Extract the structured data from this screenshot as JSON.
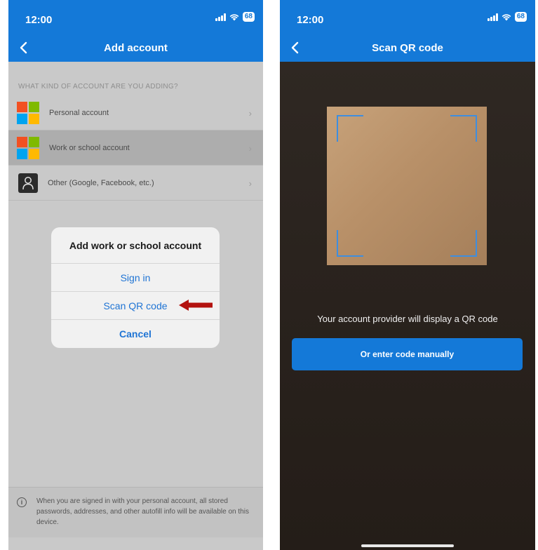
{
  "left": {
    "status_time": "12:00",
    "battery": "68",
    "nav_title": "Add account",
    "section_header": "WHAT KIND OF ACCOUNT ARE YOU ADDING?",
    "items": [
      {
        "label": "Personal account",
        "icon": "microsoft-logo-icon"
      },
      {
        "label": "Work or school account",
        "icon": "microsoft-logo-icon"
      },
      {
        "label": "Other (Google, Facebook, etc.)",
        "icon": "person-icon"
      }
    ],
    "dialog": {
      "title": "Add work or school account",
      "sign_in": "Sign in",
      "scan_qr": "Scan QR code",
      "cancel": "Cancel"
    },
    "footer_text": "When you are signed in with your personal account, all stored passwords, addresses, and other autofill info will be available on this device."
  },
  "right": {
    "status_time": "12:00",
    "battery": "68",
    "nav_title": "Scan QR code",
    "caption": "Your account provider will display a QR code",
    "manual_button": "Or enter code manually"
  },
  "colors": {
    "brand_blue": "#1479d8",
    "arrow_red": "#b3120f",
    "ms_red": "#f25022",
    "ms_green": "#7fba00",
    "ms_blue": "#00a4ef",
    "ms_yellow": "#ffb900"
  }
}
